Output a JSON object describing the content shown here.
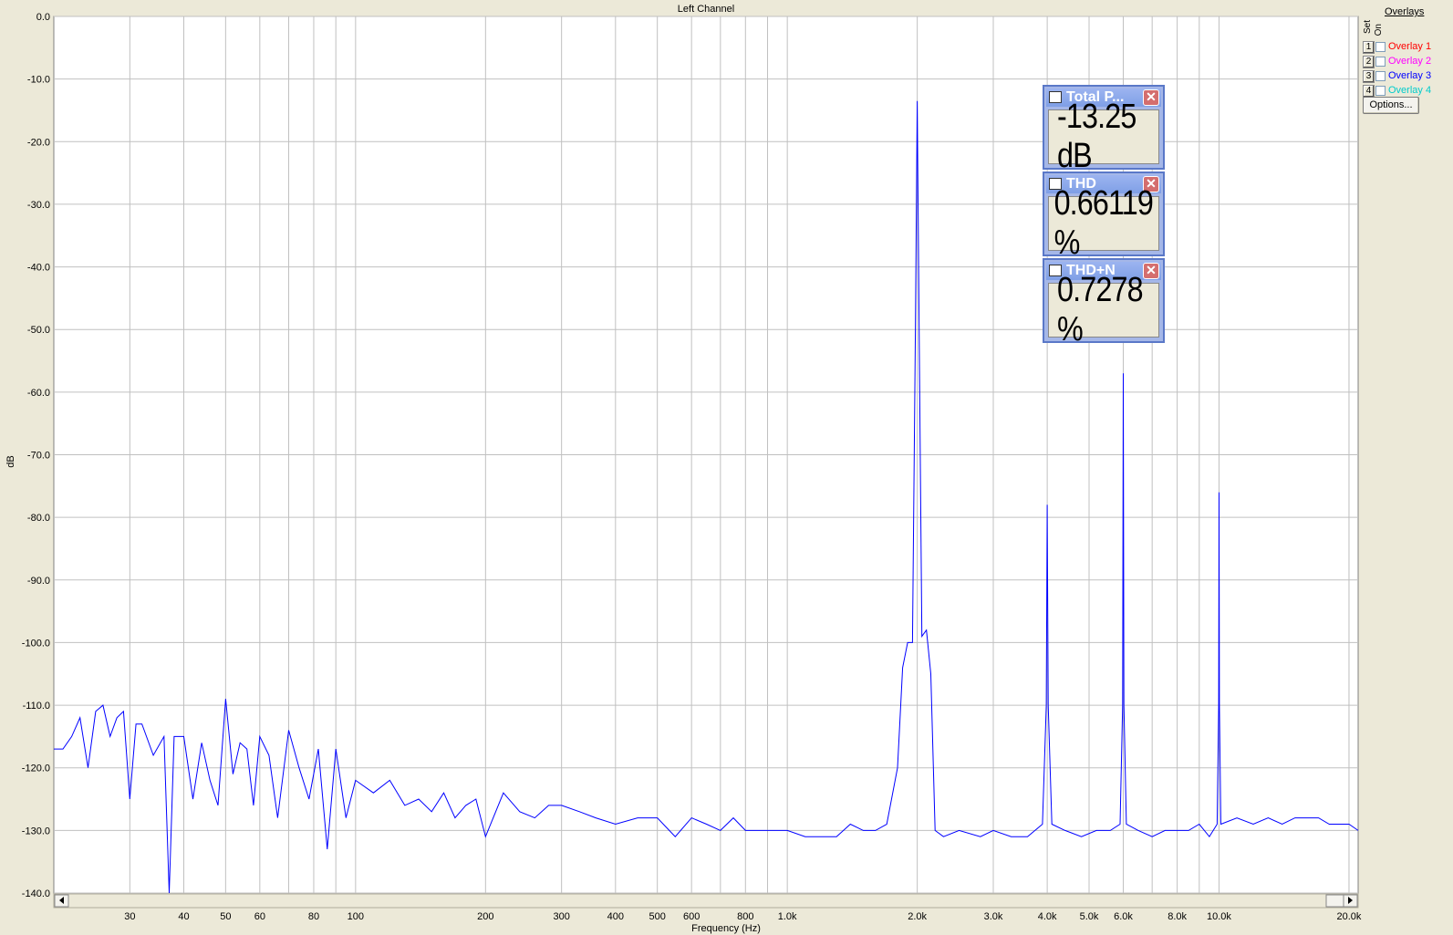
{
  "chart_data": {
    "type": "line",
    "title": "Left Channel",
    "xlabel": "Frequency (Hz)",
    "ylabel": "dB",
    "x_scale": "log",
    "xlim": [
      20,
      21000
    ],
    "ylim": [
      -140,
      0
    ],
    "grid": true,
    "y_ticks": [
      "0.0",
      "-10.0",
      "-20.0",
      "-30.0",
      "-40.0",
      "-50.0",
      "-60.0",
      "-70.0",
      "-80.0",
      "-90.0",
      "-100.0",
      "-110.0",
      "-120.0",
      "-130.0",
      "-140.0"
    ],
    "x_tick_labels": [
      {
        "v": 30,
        "t": "30"
      },
      {
        "v": 40,
        "t": "40"
      },
      {
        "v": 50,
        "t": "50"
      },
      {
        "v": 60,
        "t": "60"
      },
      {
        "v": 80,
        "t": "80"
      },
      {
        "v": 100,
        "t": "100"
      },
      {
        "v": 200,
        "t": "200"
      },
      {
        "v": 300,
        "t": "300"
      },
      {
        "v": 400,
        "t": "400"
      },
      {
        "v": 500,
        "t": "500"
      },
      {
        "v": 600,
        "t": "600"
      },
      {
        "v": 800,
        "t": "800"
      },
      {
        "v": 1000,
        "t": "1.0k"
      },
      {
        "v": 2000,
        "t": "2.0k"
      },
      {
        "v": 3000,
        "t": "3.0k"
      },
      {
        "v": 4000,
        "t": "4.0k"
      },
      {
        "v": 5000,
        "t": "5.0k"
      },
      {
        "v": 6000,
        "t": "6.0k"
      },
      {
        "v": 8000,
        "t": "8.0k"
      },
      {
        "v": 10000,
        "t": "10.0k"
      },
      {
        "v": 20000,
        "t": "20.0k"
      }
    ],
    "series": [
      {
        "color": "#0000ff",
        "x": [
          20,
          21,
          22,
          23,
          24,
          25,
          26,
          27,
          28,
          29,
          30,
          31,
          32,
          34,
          36,
          37,
          38,
          40,
          42,
          44,
          46,
          48,
          50,
          52,
          54,
          56,
          58,
          60,
          63,
          66,
          70,
          74,
          78,
          82,
          86,
          90,
          95,
          100,
          110,
          120,
          130,
          140,
          150,
          160,
          170,
          180,
          190,
          200,
          220,
          240,
          260,
          280,
          300,
          330,
          360,
          400,
          450,
          500,
          550,
          600,
          650,
          700,
          750,
          800,
          900,
          1000,
          1100,
          1200,
          1300,
          1400,
          1500,
          1600,
          1700,
          1800,
          1850,
          1900,
          1950,
          1980,
          2000,
          2020,
          2050,
          2100,
          2150,
          2200,
          2300,
          2500,
          2800,
          3000,
          3300,
          3600,
          3900,
          3980,
          4000,
          4020,
          4100,
          4400,
          4800,
          5200,
          5600,
          5900,
          5980,
          6000,
          6020,
          6100,
          6500,
          7000,
          7500,
          8000,
          8500,
          9000,
          9500,
          9900,
          9980,
          10000,
          10020,
          10100,
          11000,
          12000,
          13000,
          14000,
          15000,
          16000,
          17000,
          18000,
          19000,
          20000,
          21000
        ],
        "y": [
          -117,
          -117,
          -115,
          -112,
          -120,
          -111,
          -110,
          -115,
          -112,
          -111,
          -125,
          -113,
          -113,
          -118,
          -115,
          -140,
          -115,
          -115,
          -125,
          -116,
          -122,
          -126,
          -109,
          -121,
          -116,
          -117,
          -126,
          -115,
          -118,
          -128,
          -114,
          -120,
          -125,
          -117,
          -133,
          -117,
          -128,
          -122,
          -124,
          -122,
          -126,
          -125,
          -127,
          -124,
          -128,
          -126,
          -125,
          -131,
          -124,
          -127,
          -128,
          -126,
          -126,
          -127,
          -128,
          -129,
          -128,
          -128,
          -131,
          -128,
          -129,
          -130,
          -128,
          -130,
          -130,
          -130,
          -131,
          -131,
          -131,
          -129,
          -130,
          -130,
          -129,
          -120,
          -104,
          -100,
          -100,
          -50,
          -13.5,
          -50,
          -99,
          -98,
          -105,
          -130,
          -131,
          -130,
          -131,
          -130,
          -131,
          -131,
          -129,
          -110,
          -78,
          -110,
          -129,
          -130,
          -131,
          -130,
          -130,
          -129,
          -110,
          -57,
          -110,
          -129,
          -130,
          -131,
          -130,
          -130,
          -130,
          -129,
          -131,
          -129,
          -110,
          -76,
          -110,
          -129,
          -128,
          -129,
          -128,
          -129,
          -128,
          -128,
          -128,
          -129,
          -129,
          -129,
          -130
        ]
      }
    ]
  },
  "overlays": {
    "title": "Overlays",
    "set_label": "Set",
    "on_label": "On",
    "items": [
      {
        "num": "1",
        "label": "Overlay 1",
        "color": "#ff0000"
      },
      {
        "num": "2",
        "label": "Overlay 2",
        "color": "#ff00ff"
      },
      {
        "num": "3",
        "label": "Overlay 3",
        "color": "#0000ff"
      },
      {
        "num": "4",
        "label": "Overlay 4",
        "color": "#00cccc"
      }
    ],
    "options_label": "Options..."
  },
  "meters": [
    {
      "name": "Total P...",
      "value": "-13.25 dB"
    },
    {
      "name": "THD",
      "value": "0.66119 %"
    },
    {
      "name": "THD+N",
      "value": "0.7278 %"
    }
  ]
}
